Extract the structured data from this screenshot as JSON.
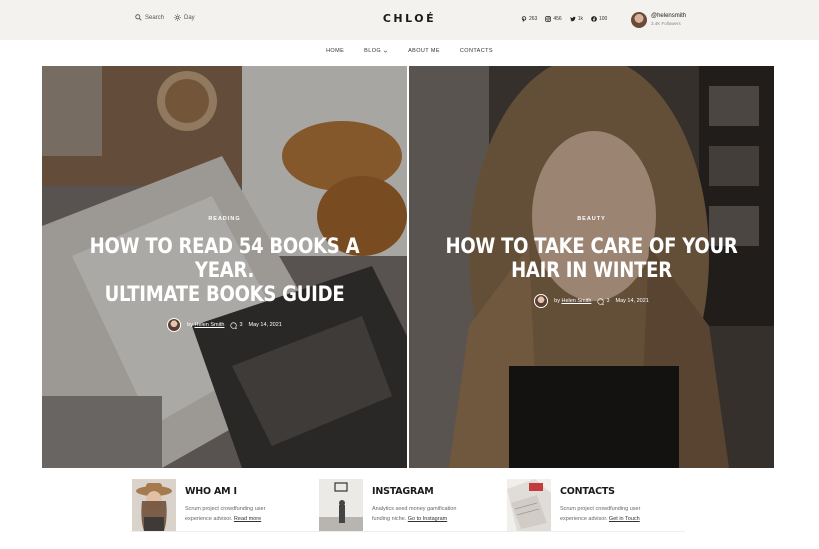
{
  "topbar": {
    "search_label": "Search",
    "mode_label": "Day",
    "logo": "CHLOÉ",
    "socials": [
      {
        "icon": "pinterest-icon",
        "count": "263"
      },
      {
        "icon": "instagram-icon",
        "count": "456"
      },
      {
        "icon": "twitter-icon",
        "count": "1k"
      },
      {
        "icon": "facebook-icon",
        "count": "100"
      }
    ],
    "profile": {
      "handle": "@helensmith",
      "followers": "3.4K Followers"
    }
  },
  "nav": {
    "items": [
      "HOME",
      "BLOG",
      "ABOUT ME",
      "CONTACTS"
    ]
  },
  "posts": [
    {
      "category": "READING",
      "title_line1": "HOW TO READ 54 BOOKS A YEAR.",
      "title_line2": "ULTIMATE BOOKS GUIDE",
      "by": "by",
      "author": "Helen Smith",
      "comments": "3",
      "date": "May 14, 2021"
    },
    {
      "category": "BEAUTY",
      "title_line1": "HOW TO TAKE CARE OF YOUR",
      "title_line2": "HAIR IN WINTER",
      "by": "by",
      "author": "Helen Smith",
      "comments": "3",
      "date": "May 14, 2021"
    }
  ],
  "cards": [
    {
      "title": "WHO AM I",
      "text": "Scrum project crowdfunding user experience advisor.",
      "link": "Read more"
    },
    {
      "title": "INSTAGRAM",
      "text": "Analytics seed money gamification funding niche.",
      "link": "Go to Instagram"
    },
    {
      "title": "CONTACTS",
      "text": "Scrum project crowdfunding user experience advisor.",
      "link": "Get in Touch"
    }
  ]
}
